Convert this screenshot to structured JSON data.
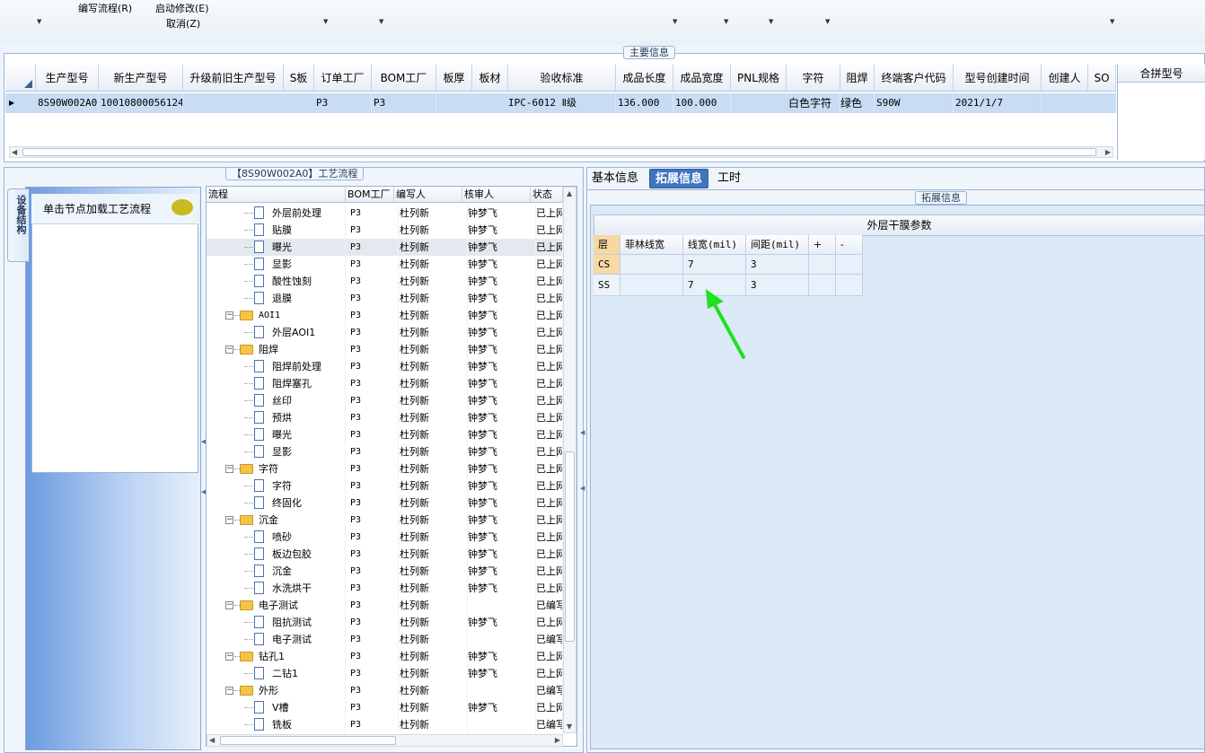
{
  "toolbar": {
    "items": [
      "编写流程(R)",
      "启动修改(E)",
      "取消(Z)"
    ]
  },
  "main_info": {
    "title": "主要信息",
    "columns": [
      "生产型号",
      "新生产型号",
      "升级前旧生产型号",
      "S板",
      "订单工厂",
      "BOM工厂",
      "板厚",
      "板材",
      "验收标准",
      "成品长度",
      "成品宽度",
      "PNL规格",
      "字符",
      "阻焊",
      "终端客户代码",
      "型号创建时间",
      "创建人",
      "SO"
    ],
    "row": [
      "8S90W002A0",
      "10010800056124",
      "",
      "",
      "P3",
      "P3",
      "",
      "",
      "IPC-6012 Ⅱ级",
      "136.000",
      "100.000",
      "",
      "白色字符",
      "绿色",
      "S90W",
      "2021/1/7",
      "",
      ""
    ],
    "merge_header": "合拼型号"
  },
  "left": {
    "panel_title": "【8S90W002A0】工艺流程",
    "side_tab": "设备结构",
    "node_hint": "单击节点加载工艺流程",
    "tree_columns": [
      "流程",
      "BOM工厂",
      "编写人",
      "核审人",
      "状态"
    ],
    "tree_rows": [
      {
        "name": "外层前处理",
        "bom": "P3",
        "writer": "杜列新",
        "reviewer": "钟梦飞",
        "status": "已上网",
        "kind": "leaf"
      },
      {
        "name": "贴膜",
        "bom": "P3",
        "writer": "杜列新",
        "reviewer": "钟梦飞",
        "status": "已上网",
        "kind": "leaf"
      },
      {
        "name": "曝光",
        "bom": "P3",
        "writer": "杜列新",
        "reviewer": "钟梦飞",
        "status": "已上网",
        "kind": "leaf"
      },
      {
        "name": "显影",
        "bom": "P3",
        "writer": "杜列新",
        "reviewer": "钟梦飞",
        "status": "已上网",
        "kind": "leaf"
      },
      {
        "name": "酸性蚀刻",
        "bom": "P3",
        "writer": "杜列新",
        "reviewer": "钟梦飞",
        "status": "已上网",
        "kind": "leaf"
      },
      {
        "name": "退膜",
        "bom": "P3",
        "writer": "杜列新",
        "reviewer": "钟梦飞",
        "status": "已上网",
        "kind": "leaf"
      },
      {
        "name": "AOI1",
        "bom": "P3",
        "writer": "杜列新",
        "reviewer": "钟梦飞",
        "status": "已上网",
        "kind": "folder"
      },
      {
        "name": "外层AOI1",
        "bom": "P3",
        "writer": "杜列新",
        "reviewer": "钟梦飞",
        "status": "已上网",
        "kind": "leaf"
      },
      {
        "name": "阻焊",
        "bom": "P3",
        "writer": "杜列新",
        "reviewer": "钟梦飞",
        "status": "已上网",
        "kind": "folder"
      },
      {
        "name": "阻焊前处理",
        "bom": "P3",
        "writer": "杜列新",
        "reviewer": "钟梦飞",
        "status": "已上网",
        "kind": "leaf"
      },
      {
        "name": "阻焊塞孔",
        "bom": "P3",
        "writer": "杜列新",
        "reviewer": "钟梦飞",
        "status": "已上网",
        "kind": "leaf"
      },
      {
        "name": "丝印",
        "bom": "P3",
        "writer": "杜列新",
        "reviewer": "钟梦飞",
        "status": "已上网",
        "kind": "leaf"
      },
      {
        "name": "预烘",
        "bom": "P3",
        "writer": "杜列新",
        "reviewer": "钟梦飞",
        "status": "已上网",
        "kind": "leaf"
      },
      {
        "name": "曝光",
        "bom": "P3",
        "writer": "杜列新",
        "reviewer": "钟梦飞",
        "status": "已上网",
        "kind": "leaf"
      },
      {
        "name": "显影",
        "bom": "P3",
        "writer": "杜列新",
        "reviewer": "钟梦飞",
        "status": "已上网",
        "kind": "leaf"
      },
      {
        "name": "字符",
        "bom": "P3",
        "writer": "杜列新",
        "reviewer": "钟梦飞",
        "status": "已上网",
        "kind": "folder"
      },
      {
        "name": "字符",
        "bom": "P3",
        "writer": "杜列新",
        "reviewer": "钟梦飞",
        "status": "已上网",
        "kind": "leaf"
      },
      {
        "name": "终固化",
        "bom": "P3",
        "writer": "杜列新",
        "reviewer": "钟梦飞",
        "status": "已上网",
        "kind": "leaf"
      },
      {
        "name": "沉金",
        "bom": "P3",
        "writer": "杜列新",
        "reviewer": "钟梦飞",
        "status": "已上网",
        "kind": "folder"
      },
      {
        "name": "喷砂",
        "bom": "P3",
        "writer": "杜列新",
        "reviewer": "钟梦飞",
        "status": "已上网",
        "kind": "leaf"
      },
      {
        "name": "板边包胶",
        "bom": "P3",
        "writer": "杜列新",
        "reviewer": "钟梦飞",
        "status": "已上网",
        "kind": "leaf"
      },
      {
        "name": "沉金",
        "bom": "P3",
        "writer": "杜列新",
        "reviewer": "钟梦飞",
        "status": "已上网",
        "kind": "leaf"
      },
      {
        "name": "水洗烘干",
        "bom": "P3",
        "writer": "杜列新",
        "reviewer": "钟梦飞",
        "status": "已上网",
        "kind": "leaf"
      },
      {
        "name": "电子测试",
        "bom": "P3",
        "writer": "杜列新",
        "reviewer": "",
        "status": "已编写",
        "kind": "folder"
      },
      {
        "name": "阻抗测试",
        "bom": "P3",
        "writer": "杜列新",
        "reviewer": "钟梦飞",
        "status": "已上网",
        "kind": "leaf"
      },
      {
        "name": "电子测试",
        "bom": "P3",
        "writer": "杜列新",
        "reviewer": "",
        "status": "已编写",
        "kind": "leaf"
      },
      {
        "name": "钻孔1",
        "bom": "P3",
        "writer": "杜列新",
        "reviewer": "钟梦飞",
        "status": "已上网",
        "kind": "folder"
      },
      {
        "name": "二钻1",
        "bom": "P3",
        "writer": "杜列新",
        "reviewer": "钟梦飞",
        "status": "已上网",
        "kind": "leaf"
      },
      {
        "name": "外形",
        "bom": "P3",
        "writer": "杜列新",
        "reviewer": "",
        "status": "已编写",
        "kind": "folder"
      },
      {
        "name": "V槽",
        "bom": "P3",
        "writer": "杜列新",
        "reviewer": "钟梦飞",
        "status": "已上网",
        "kind": "leaf"
      },
      {
        "name": "铣板",
        "bom": "P3",
        "writer": "杜列新",
        "reviewer": "",
        "status": "已编写",
        "kind": "leaf"
      }
    ]
  },
  "right": {
    "tabs": [
      "基本信息",
      "拓展信息",
      "工时"
    ],
    "ext_title": "拓展信息",
    "dry_film_title": "外层干膜参数",
    "param_columns": [
      "层",
      "菲林线宽",
      "线宽(mil)",
      "间距(mil)",
      "+",
      "-"
    ],
    "param_rows": [
      [
        "CS",
        "",
        "7",
        "3",
        "",
        ""
      ],
      [
        "SS",
        "",
        "7",
        "3",
        "",
        ""
      ]
    ]
  },
  "colors": {
    "accent": "#3f74c1",
    "arrow": "#22e022",
    "selected_row": "#c8dcf4"
  }
}
